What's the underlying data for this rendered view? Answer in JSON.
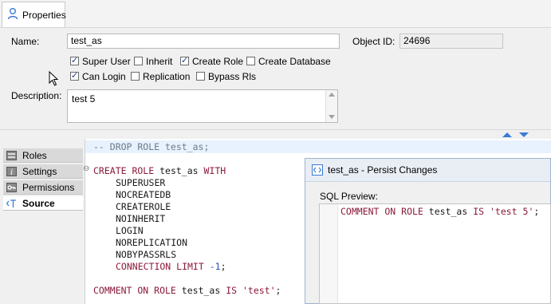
{
  "tabs": [
    {
      "label": "Properties",
      "icon": "user-icon"
    }
  ],
  "form": {
    "name_label": "Name:",
    "name_value": "test_as",
    "object_id_label": "Object ID:",
    "object_id_value": "24696",
    "checkboxes": [
      {
        "label": "Super User",
        "checked": true
      },
      {
        "label": "Inherit",
        "checked": false
      },
      {
        "label": "Create Role",
        "checked": true
      },
      {
        "label": "Create Database",
        "checked": false
      },
      {
        "label": "Can Login",
        "checked": true
      },
      {
        "label": "Replication",
        "checked": false
      },
      {
        "label": "Bypass Rls",
        "checked": false
      }
    ],
    "description_label": "Description:",
    "description_value": "test 5"
  },
  "sidebar": {
    "items": [
      {
        "label": "Roles",
        "icon": "roles-icon"
      },
      {
        "label": "Settings",
        "icon": "info-icon"
      },
      {
        "label": "Permissions",
        "icon": "key-icon"
      },
      {
        "label": "Source",
        "icon": "source-icon",
        "active": true
      }
    ]
  },
  "editor": {
    "line_comment": "-- DROP ROLE test_as;",
    "create_kw": "CREATE ROLE",
    "role_name": "test_as",
    "with_kw": "WITH",
    "options": [
      "SUPERUSER",
      "NOCREATEDB",
      "CREATEROLE",
      "NOINHERIT",
      "LOGIN",
      "NOREPLICATION",
      "NOBYPASSRLS"
    ],
    "conn_kw": "CONNECTION LIMIT",
    "conn_value": "-1",
    "semicolon": ";",
    "comment_kw": "COMMENT ON ROLE",
    "is_kw": "IS",
    "comment_value": "'test'"
  },
  "dialog": {
    "title": "test_as - Persist Changes",
    "sql_preview_label": "SQL Preview:",
    "sql_kw": "COMMENT ON ROLE",
    "sql_role": "test_as",
    "sql_is": "IS",
    "sql_value": "'test 5'",
    "sql_semicolon": ";"
  },
  "colors": {
    "keyword": "#8b1a3a",
    "comment": "#6a7b8a",
    "number": "#2a4dbd",
    "accent": "#3a7bd5"
  }
}
